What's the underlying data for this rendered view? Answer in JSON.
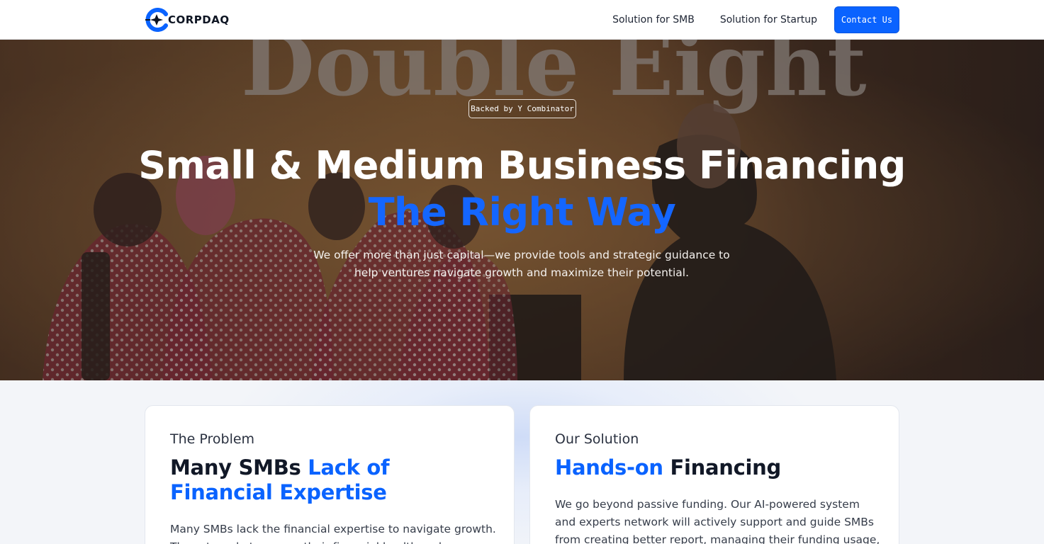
{
  "header": {
    "logo_text": "CORPDAQ",
    "nav": [
      "Solution for SMB",
      "Solution for Startup"
    ],
    "contact_label": "Contact Us"
  },
  "hero": {
    "badge": "Backed by Y Combinator",
    "title": "Small & Medium Business Financing",
    "accent": "The Right Way",
    "description": "We offer more than just capital—we provide tools and strategic guidance to help ventures navigate growth and maximize their potential.",
    "background_sign_text": "Double Eight"
  },
  "problem": {
    "eyebrow": "The Problem",
    "title_plain": "Many SMBs ",
    "title_accent": "Lack of Financial Expertise",
    "body": "Many SMBs lack the financial expertise to navigate growth. They struggle to assess their financial health and secure"
  },
  "solution": {
    "eyebrow": "Our Solution",
    "title_accent": "Hands-on",
    "title_plain": " Financing",
    "body": "We go beyond passive funding. Our AI-powered system and experts network will actively support and guide SMBs from creating better report, managing their funding usage, detecting"
  },
  "colors": {
    "brand_blue": "#0a63ff",
    "hero_accent": "#1466ff",
    "page_bg": "#f3f5f9"
  }
}
